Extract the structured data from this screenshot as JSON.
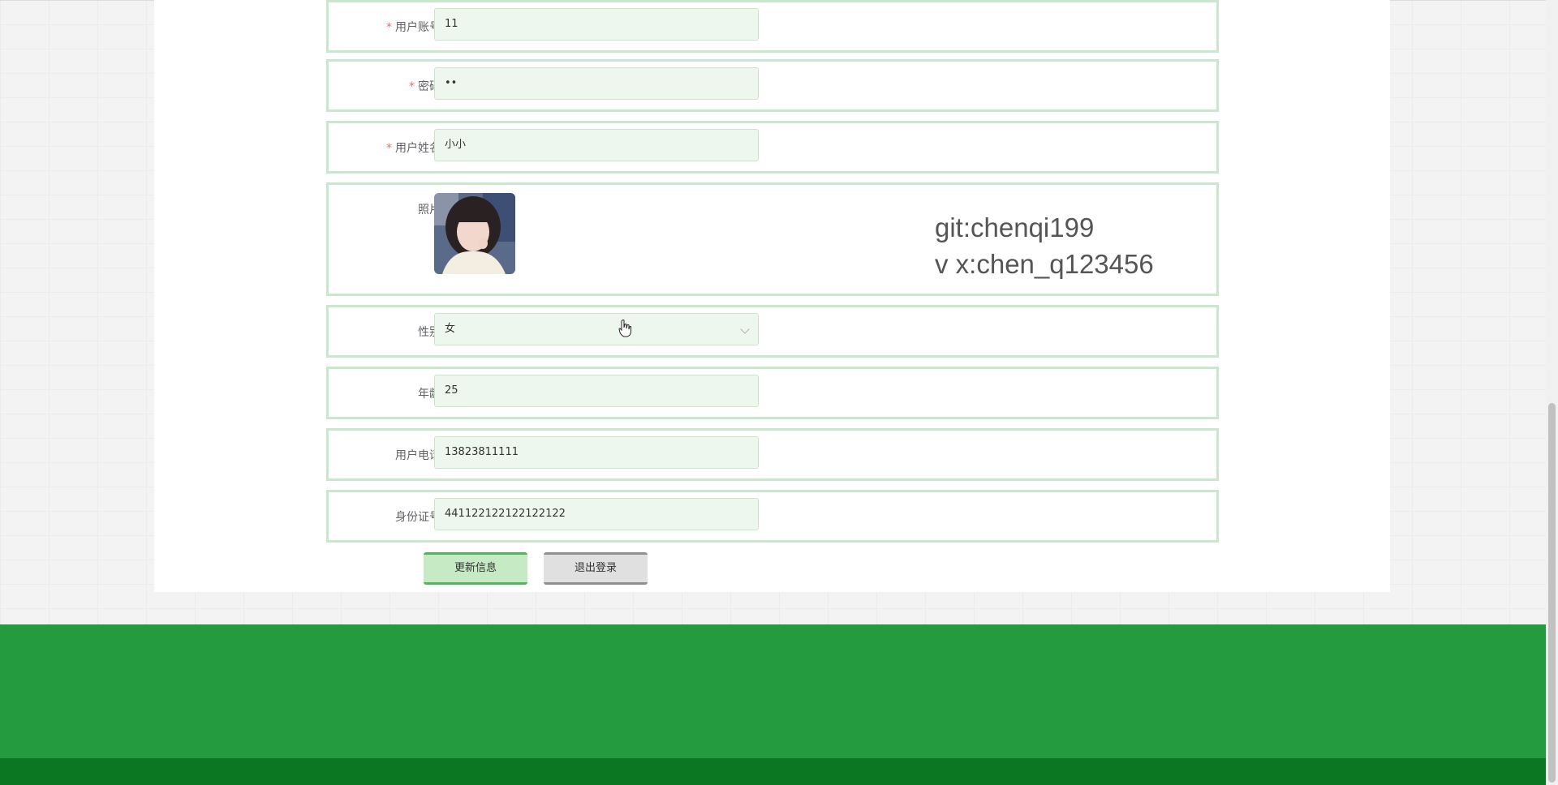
{
  "form": {
    "account": {
      "label": "用户账号",
      "value": "11",
      "required": true
    },
    "password": {
      "label": "密码",
      "value": "••",
      "required": true
    },
    "name": {
      "label": "用户姓名",
      "value": "小小",
      "required": true
    },
    "photo": {
      "label": "照片"
    },
    "gender": {
      "label": "性别",
      "value": "女"
    },
    "age": {
      "label": "年龄",
      "value": "25"
    },
    "phone": {
      "label": "用户电话",
      "value": "13823811111"
    },
    "id_card": {
      "label": "身份证号",
      "value": "441122122122122122"
    }
  },
  "watermark": {
    "line1": "git:chenqi199",
    "line2": "v x:chen_q123456"
  },
  "buttons": {
    "update": "更新信息",
    "logout": "退出登录"
  },
  "colors": {
    "footer": "#249b3e",
    "footer_bottom": "#0b7722",
    "accent": "#53b45b"
  }
}
